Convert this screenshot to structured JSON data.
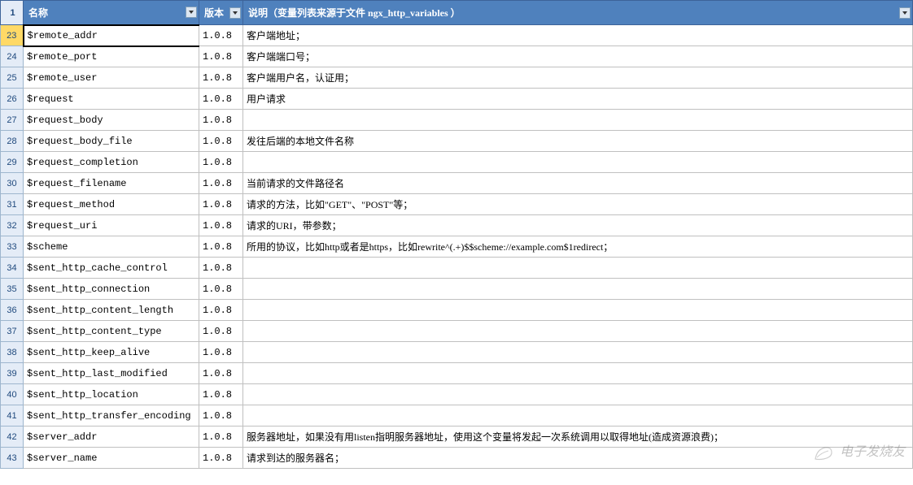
{
  "header": {
    "row_num": "1",
    "columns": {
      "name": "名称",
      "version": "版本",
      "desc": "说明（变量列表来源于文件 ngx_http_variables ）"
    }
  },
  "rows": [
    {
      "num": "23",
      "name": "$remote_addr",
      "version": "1.0.8",
      "desc": "客户端地址；",
      "selected": true
    },
    {
      "num": "24",
      "name": "$remote_port",
      "version": "1.0.8",
      "desc": "客户端端口号；"
    },
    {
      "num": "25",
      "name": "$remote_user",
      "version": "1.0.8",
      "desc": "客户端用户名，认证用；"
    },
    {
      "num": "26",
      "name": "$request",
      "version": "1.0.8",
      "desc": "用户请求"
    },
    {
      "num": "27",
      "name": "$request_body",
      "version": "1.0.8",
      "desc": ""
    },
    {
      "num": "28",
      "name": "$request_body_file",
      "version": "1.0.8",
      "desc": "发往后端的本地文件名称"
    },
    {
      "num": "29",
      "name": "$request_completion",
      "version": "1.0.8",
      "desc": ""
    },
    {
      "num": "30",
      "name": "$request_filename",
      "version": "1.0.8",
      "desc": "当前请求的文件路径名"
    },
    {
      "num": "31",
      "name": "$request_method",
      "version": "1.0.8",
      "desc": "请求的方法，比如\"GET\"、\"POST\"等；"
    },
    {
      "num": "32",
      "name": "$request_uri",
      "version": "1.0.8",
      "desc": "请求的URI，带参数；"
    },
    {
      "num": "33",
      "name": "$scheme",
      "version": "1.0.8",
      "desc": "所用的协议，比如http或者是https，比如rewrite^(.+)$$scheme://example.com$1redirect；"
    },
    {
      "num": "34",
      "name": "$sent_http_cache_control",
      "version": "1.0.8",
      "desc": ""
    },
    {
      "num": "35",
      "name": "$sent_http_connection",
      "version": "1.0.8",
      "desc": ""
    },
    {
      "num": "36",
      "name": "$sent_http_content_length",
      "version": "1.0.8",
      "desc": ""
    },
    {
      "num": "37",
      "name": "$sent_http_content_type",
      "version": "1.0.8",
      "desc": ""
    },
    {
      "num": "38",
      "name": "$sent_http_keep_alive",
      "version": "1.0.8",
      "desc": ""
    },
    {
      "num": "39",
      "name": "$sent_http_last_modified",
      "version": "1.0.8",
      "desc": ""
    },
    {
      "num": "40",
      "name": "$sent_http_location",
      "version": "1.0.8",
      "desc": ""
    },
    {
      "num": "41",
      "name": "$sent_http_transfer_encoding",
      "version": "1.0.8",
      "desc": ""
    },
    {
      "num": "42",
      "name": "$server_addr",
      "version": "1.0.8",
      "desc": "服务器地址，如果没有用listen指明服务器地址，使用这个变量将发起一次系统调用以取得地址(造成资源浪费)；"
    },
    {
      "num": "43",
      "name": "$server_name",
      "version": "1.0.8",
      "desc": "请求到达的服务器名；"
    }
  ],
  "watermark": "电子发烧友"
}
